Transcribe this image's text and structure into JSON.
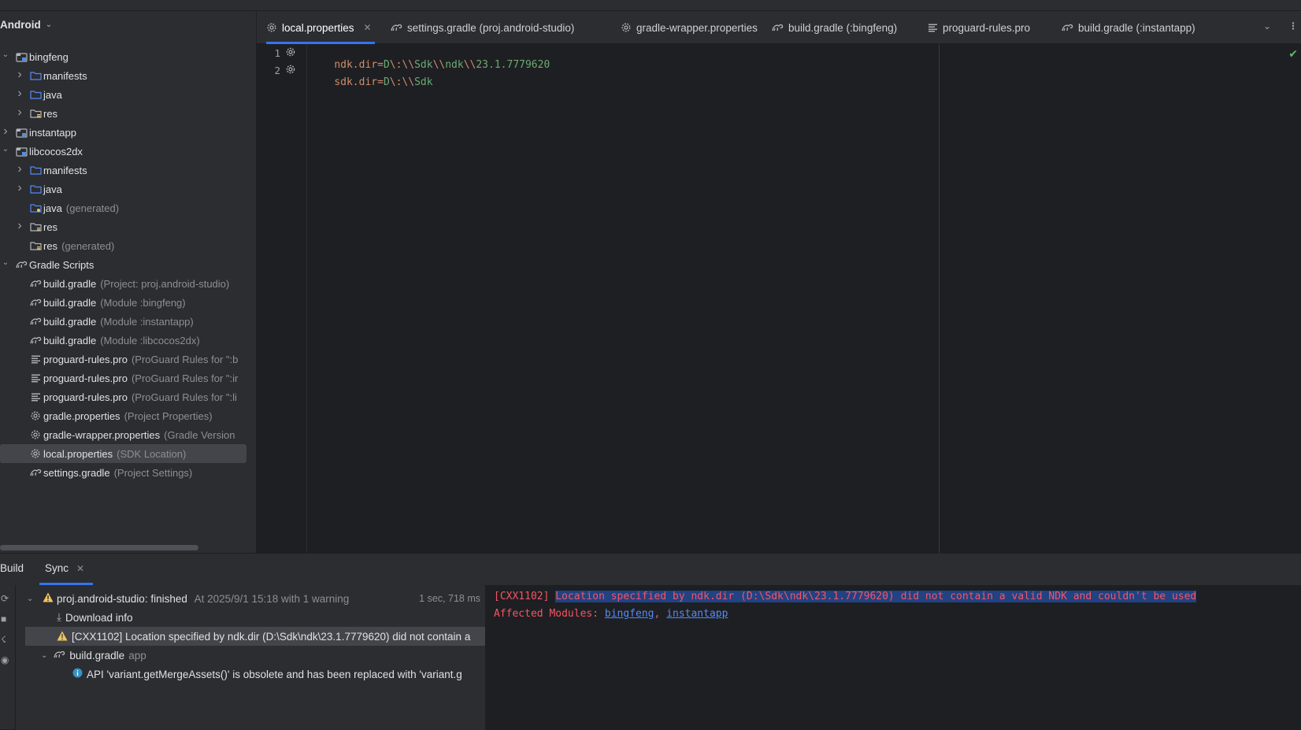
{
  "project_panel": {
    "view_selector": "Android",
    "tree": [
      {
        "label": "bingfeng",
        "sub": "",
        "level": 0,
        "expanded": true,
        "icon": "module-icon"
      },
      {
        "label": "manifests",
        "sub": "",
        "level": 1,
        "expanded": false,
        "icon": "folder-icon"
      },
      {
        "label": "java",
        "sub": "",
        "level": 1,
        "expanded": false,
        "icon": "folder-icon"
      },
      {
        "label": "res",
        "sub": "",
        "level": 1,
        "expanded": false,
        "icon": "res-folder-icon"
      },
      {
        "label": "instantapp",
        "sub": "",
        "level": 0,
        "expanded": false,
        "icon": "module-icon"
      },
      {
        "label": "libcocos2dx",
        "sub": "",
        "level": 0,
        "expanded": true,
        "icon": "module-icon"
      },
      {
        "label": "manifests",
        "sub": "",
        "level": 1,
        "expanded": false,
        "icon": "folder-icon"
      },
      {
        "label": "java",
        "sub": "",
        "level": 1,
        "expanded": false,
        "icon": "folder-icon"
      },
      {
        "label": "java",
        "sub": "(generated)",
        "level": 1,
        "expanded": null,
        "icon": "generated-folder-icon"
      },
      {
        "label": "res",
        "sub": "",
        "level": 1,
        "expanded": false,
        "icon": "res-folder-icon"
      },
      {
        "label": "res",
        "sub": "(generated)",
        "level": 1,
        "expanded": null,
        "icon": "res-folder-icon"
      },
      {
        "label": "Gradle Scripts",
        "sub": "",
        "level": 0,
        "expanded": true,
        "icon": "gradle-icon"
      },
      {
        "label": "build.gradle",
        "sub": "(Project: proj.android-studio)",
        "level": 1,
        "expanded": null,
        "icon": "gradle-icon"
      },
      {
        "label": "build.gradle",
        "sub": "(Module :bingfeng)",
        "level": 1,
        "expanded": null,
        "icon": "gradle-icon"
      },
      {
        "label": "build.gradle",
        "sub": "(Module :instantapp)",
        "level": 1,
        "expanded": null,
        "icon": "gradle-icon"
      },
      {
        "label": "build.gradle",
        "sub": "(Module :libcocos2dx)",
        "level": 1,
        "expanded": null,
        "icon": "gradle-icon"
      },
      {
        "label": "proguard-rules.pro",
        "sub": "(ProGuard Rules for \":b",
        "level": 1,
        "expanded": null,
        "icon": "text-file-icon"
      },
      {
        "label": "proguard-rules.pro",
        "sub": "(ProGuard Rules for \":ir",
        "level": 1,
        "expanded": null,
        "icon": "text-file-icon"
      },
      {
        "label": "proguard-rules.pro",
        "sub": "(ProGuard Rules for \":li",
        "level": 1,
        "expanded": null,
        "icon": "text-file-icon"
      },
      {
        "label": "gradle.properties",
        "sub": "(Project Properties)",
        "level": 1,
        "expanded": null,
        "icon": "settings-file-icon"
      },
      {
        "label": "gradle-wrapper.properties",
        "sub": "(Gradle Version",
        "level": 1,
        "expanded": null,
        "icon": "settings-file-icon"
      },
      {
        "label": "local.properties",
        "sub": "(SDK Location)",
        "level": 1,
        "expanded": null,
        "icon": "settings-file-icon",
        "selected": true
      },
      {
        "label": "settings.gradle",
        "sub": "(Project Settings)",
        "level": 1,
        "expanded": null,
        "icon": "gradle-icon"
      }
    ]
  },
  "editor_tabs": [
    {
      "label": "local.properties",
      "icon": "settings-file-icon",
      "active": true,
      "closable": true
    },
    {
      "label": "settings.gradle (proj.android-studio)",
      "icon": "gradle-icon",
      "active": false,
      "closable": false
    },
    {
      "label": "gradle-wrapper.properties",
      "icon": "settings-file-icon",
      "active": false,
      "closable": false
    },
    {
      "label": "build.gradle (:bingfeng)",
      "icon": "gradle-icon",
      "active": false,
      "closable": false
    },
    {
      "label": "proguard-rules.pro",
      "icon": "text-file-icon",
      "active": false,
      "closable": false
    },
    {
      "label": "build.gradle (:instantapp)",
      "icon": "gradle-icon",
      "active": false,
      "closable": false
    }
  ],
  "editor": {
    "lines": [
      {
        "number": "1",
        "key": "ndk.dir",
        "value_parts": [
          "D",
          "\\:",
          "\\\\",
          "Sdk",
          "\\\\",
          "ndk",
          "\\\\",
          "23.1.7779620"
        ]
      },
      {
        "number": "2",
        "key": "sdk.dir",
        "value_parts": [
          "D",
          "\\:",
          "\\\\",
          "Sdk"
        ]
      }
    ]
  },
  "build_panel": {
    "tabs": [
      {
        "label": "Build"
      },
      {
        "label": "Sync",
        "closable": true
      }
    ],
    "tree": {
      "root_name": "proj.android-studio:",
      "root_status": "finished",
      "root_detail": "At 2025/9/1 15:18 with 1 warning",
      "root_time": "1 sec, 718 ms",
      "download": "Download info",
      "warning": "[CXX1102] Location specified by ndk.dir (D:\\Sdk\\ndk\\23.1.7779620) did not contain a",
      "build_gradle": "build.gradle",
      "build_gradle_sub": "app",
      "info": "API 'variant.getMergeAssets()' is obsolete and has been replaced with 'variant.g"
    },
    "console": {
      "code": "[CXX1102]",
      "message": "Location specified by ndk.dir (D:\\Sdk\\ndk\\23.1.7779620) did not contain a valid NDK and couldn't be used",
      "affected_label": "Affected Modules:",
      "modules": [
        "bingfeng",
        "instantapp"
      ],
      "separator": ", "
    }
  }
}
